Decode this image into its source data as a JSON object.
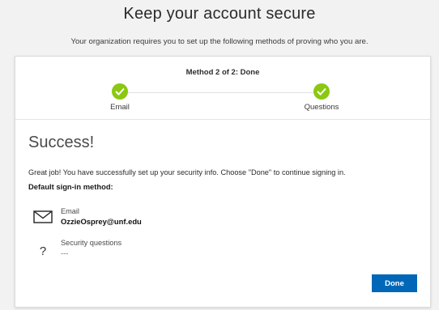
{
  "header": {
    "title": "Keep your account secure",
    "subtitle": "Your organization requires you to set up the following methods of proving who you are."
  },
  "progress": {
    "title": "Method 2 of 2: Done",
    "steps": [
      {
        "label": "Email",
        "status": "complete"
      },
      {
        "label": "Questions",
        "status": "complete"
      }
    ]
  },
  "result": {
    "heading": "Success!",
    "message": "Great job! You have successfully set up your security info. Choose \"Done\" to continue signing in.",
    "default_method_heading": "Default sign-in method:"
  },
  "methods": [
    {
      "name": "Email",
      "value": "OzzieOsprey@unf.edu",
      "icon": "envelope-icon"
    },
    {
      "name": "Security questions",
      "value": "---",
      "icon": "question-mark-icon"
    }
  ],
  "actions": {
    "done_label": "Done"
  },
  "colors": {
    "accent": "#0067b8",
    "success": "#8bc812",
    "background": "#f2f2f2"
  }
}
